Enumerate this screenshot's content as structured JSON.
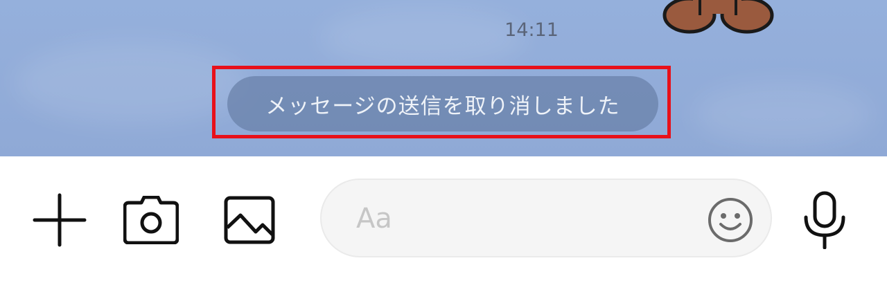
{
  "chat": {
    "timestamp": "14:11",
    "system_message": "メッセージの送信を取り消しました"
  },
  "composer": {
    "placeholder": "Aa"
  },
  "icons": {
    "plus": "plus-icon",
    "camera": "camera-icon",
    "image": "image-icon",
    "emoji": "smiley-icon",
    "mic": "microphone-icon"
  },
  "colors": {
    "chat_background": "#8fa9d6",
    "highlight_border": "#e8101a",
    "system_pill": "#6880a8"
  }
}
